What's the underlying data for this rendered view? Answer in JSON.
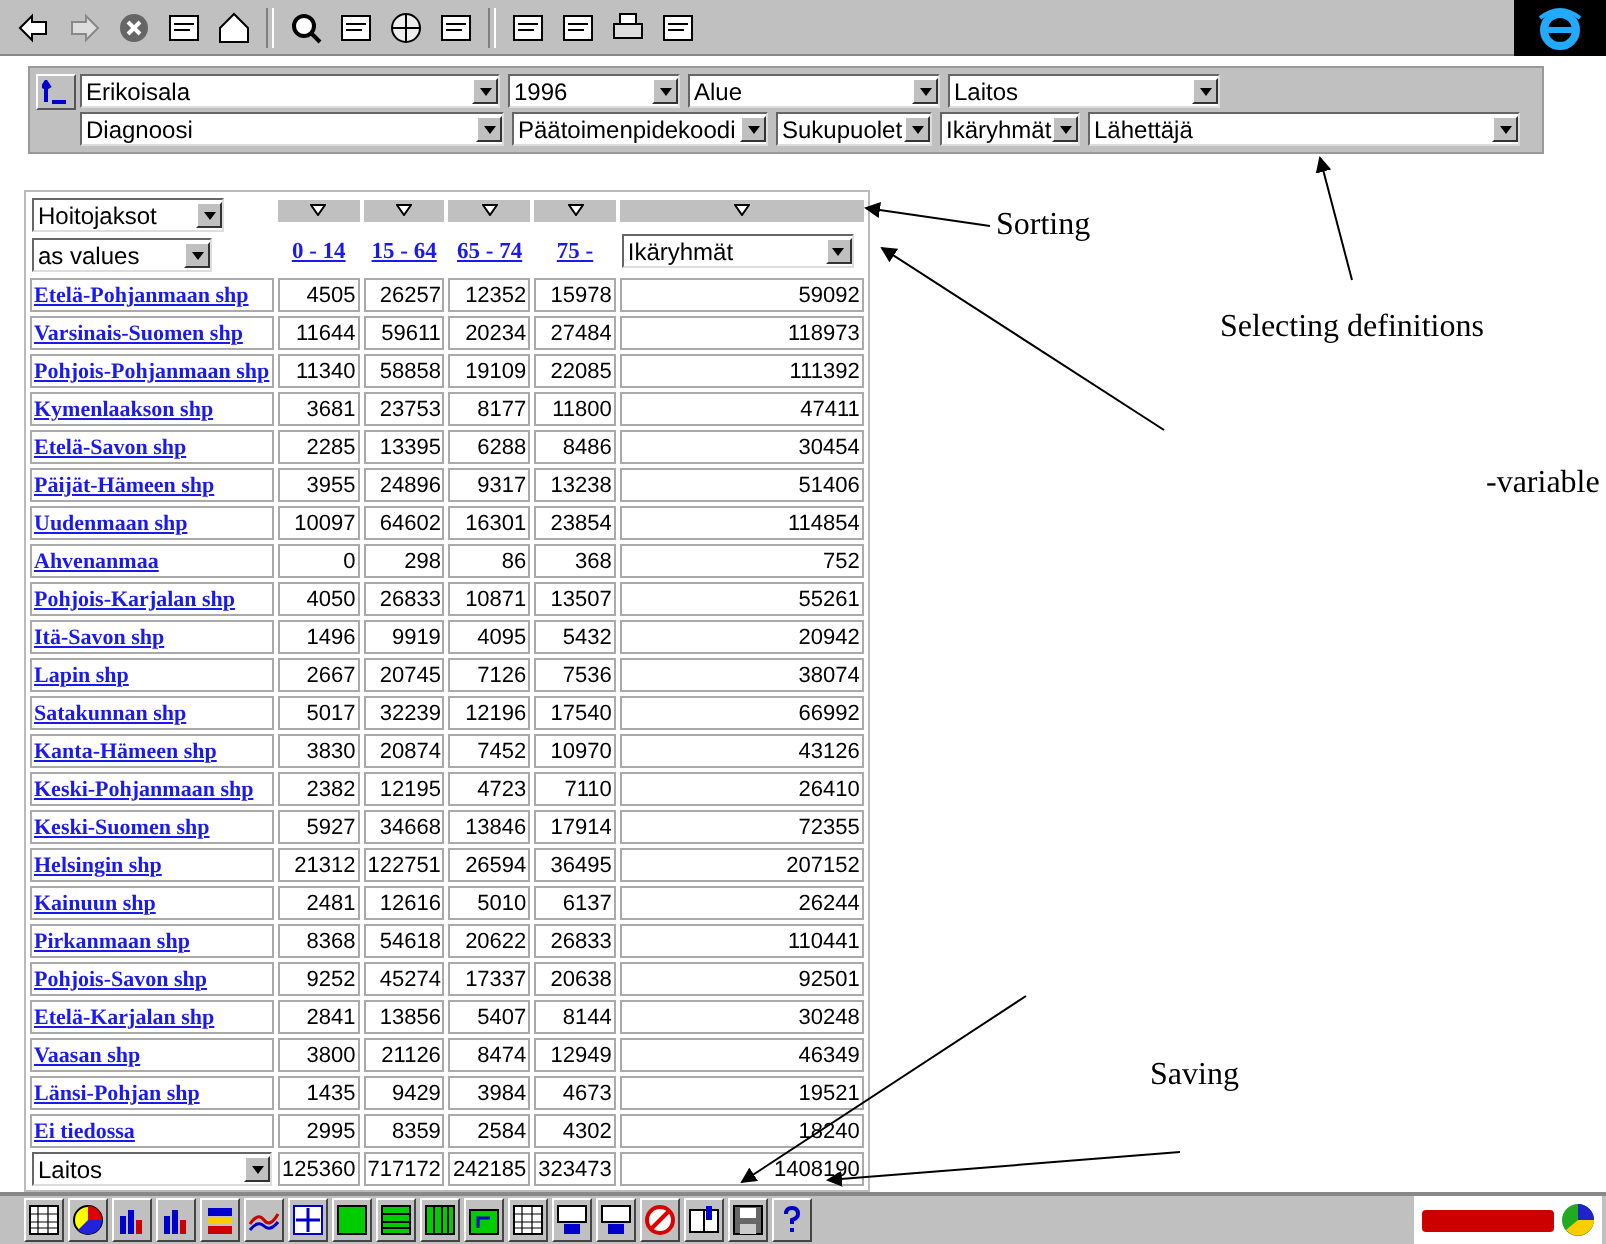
{
  "filters": {
    "rows": [
      {
        "items": [
          "Erikoisala",
          "1996",
          "Alue",
          "Laitos"
        ]
      },
      {
        "items": [
          "Diagnoosi",
          "Päätoimenpidekoodi",
          "Sukupuolet",
          "Ikäryhmät",
          "Lähettäjä"
        ]
      }
    ]
  },
  "table": {
    "measure": "Hoitojaksot",
    "display": "as values",
    "columns": [
      "0 - 14",
      "15 - 64",
      "65 - 74",
      "75 -"
    ],
    "column_dimension": "Ikäryhmät",
    "rows": [
      {
        "name": "Etelä-Pohjanmaan shp",
        "values": [
          "4505",
          "26257",
          "12352",
          "15978",
          "59092"
        ]
      },
      {
        "name": "Varsinais-Suomen shp",
        "values": [
          "11644",
          "59611",
          "20234",
          "27484",
          "118973"
        ]
      },
      {
        "name": "Pohjois-Pohjanmaan shp",
        "values": [
          "11340",
          "58858",
          "19109",
          "22085",
          "111392"
        ]
      },
      {
        "name": "Kymenlaakson shp",
        "values": [
          "3681",
          "23753",
          "8177",
          "11800",
          "47411"
        ]
      },
      {
        "name": "Etelä-Savon shp",
        "values": [
          "2285",
          "13395",
          "6288",
          "8486",
          "30454"
        ]
      },
      {
        "name": "Päijät-Hämeen shp",
        "values": [
          "3955",
          "24896",
          "9317",
          "13238",
          "51406"
        ]
      },
      {
        "name": "Uudenmaan shp",
        "values": [
          "10097",
          "64602",
          "16301",
          "23854",
          "114854"
        ]
      },
      {
        "name": "Ahvenanmaa",
        "values": [
          "0",
          "298",
          "86",
          "368",
          "752"
        ]
      },
      {
        "name": "Pohjois-Karjalan shp",
        "values": [
          "4050",
          "26833",
          "10871",
          "13507",
          "55261"
        ]
      },
      {
        "name": "Itä-Savon shp",
        "values": [
          "1496",
          "9919",
          "4095",
          "5432",
          "20942"
        ]
      },
      {
        "name": "Lapin shp",
        "values": [
          "2667",
          "20745",
          "7126",
          "7536",
          "38074"
        ]
      },
      {
        "name": "Satakunnan shp",
        "values": [
          "5017",
          "32239",
          "12196",
          "17540",
          "66992"
        ]
      },
      {
        "name": "Kanta-Hämeen shp",
        "values": [
          "3830",
          "20874",
          "7452",
          "10970",
          "43126"
        ]
      },
      {
        "name": "Keski-Pohjanmaan shp",
        "values": [
          "2382",
          "12195",
          "4723",
          "7110",
          "26410"
        ]
      },
      {
        "name": "Keski-Suomen shp",
        "values": [
          "5927",
          "34668",
          "13846",
          "17914",
          "72355"
        ]
      },
      {
        "name": "Helsingin shp",
        "values": [
          "21312",
          "122751",
          "26594",
          "36495",
          "207152"
        ]
      },
      {
        "name": "Kainuun shp",
        "values": [
          "2481",
          "12616",
          "5010",
          "6137",
          "26244"
        ]
      },
      {
        "name": "Pirkanmaan shp",
        "values": [
          "8368",
          "54618",
          "20622",
          "26833",
          "110441"
        ]
      },
      {
        "name": "Pohjois-Savon shp",
        "values": [
          "9252",
          "45274",
          "17337",
          "20638",
          "92501"
        ]
      },
      {
        "name": "Etelä-Karjalan shp",
        "values": [
          "2841",
          "13856",
          "5407",
          "8144",
          "30248"
        ]
      },
      {
        "name": "Vaasan shp",
        "values": [
          "3800",
          "21126",
          "8474",
          "12949",
          "46349"
        ]
      },
      {
        "name": "Länsi-Pohjan shp",
        "values": [
          "1435",
          "9429",
          "3984",
          "4673",
          "19521"
        ]
      },
      {
        "name": "Ei tiedossa",
        "values": [
          "2995",
          "8359",
          "2584",
          "4302",
          "18240"
        ]
      }
    ],
    "footer": {
      "dimension": "Laitos",
      "values": [
        "125360",
        "717172",
        "242185",
        "323473",
        "1408190"
      ]
    }
  },
  "annotations": [
    {
      "text": "Sorting"
    },
    {
      "text": "Selecting definitions"
    },
    {
      "text": "-variable"
    },
    {
      "text": "Saving"
    }
  ]
}
